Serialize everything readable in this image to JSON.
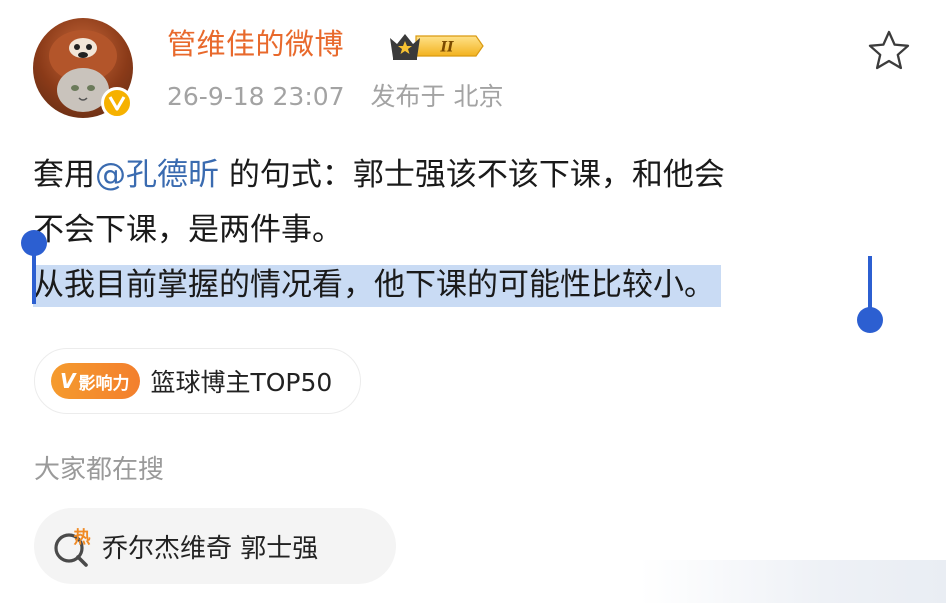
{
  "post": {
    "author_name": "管维佳的微博",
    "badge_numeral": "II",
    "timestamp": "26-9-18 23:07",
    "source": "发布于 北京",
    "content": {
      "line1_prefix": "套用",
      "mention": "@孔德昕",
      "line1_suffix": "的句式：郭士强该不该下课，和他会",
      "line2": "不会下课，是两件事。",
      "line3_selected": "从我目前掌握的情况看，他下课的可能性比较小。"
    },
    "influence_tag": {
      "label": "影响力",
      "v_letter": "V",
      "text": "篮球博主TOP50"
    }
  },
  "search": {
    "heading": "大家都在搜",
    "hot_label": "热",
    "query": "乔尔杰维奇 郭士强"
  },
  "colors": {
    "author": "#e8692c",
    "mention": "#3a6bb0",
    "selection": "#c9dbf4",
    "selection_handle": "#2c5fd1",
    "verified_badge": "#f6b100",
    "influence_gradient_start": "#f59b2e",
    "influence_gradient_end": "#f37f2d",
    "hot_icon": "#f08a24"
  },
  "icons": {
    "star": "star-outline-icon",
    "verified": "verified-v-icon",
    "crown": "crown-badge-icon",
    "search": "hot-search-icon"
  }
}
